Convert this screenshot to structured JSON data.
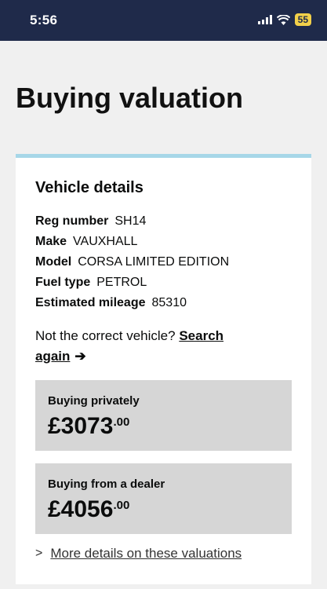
{
  "status": {
    "time": "5:56",
    "battery": "55"
  },
  "page": {
    "title": "Buying valuation"
  },
  "vehicle": {
    "heading": "Vehicle details",
    "reg_label": "Reg number",
    "reg_value": "SH14",
    "make_label": "Make",
    "make_value": "VAUXHALL",
    "model_label": "Model",
    "model_value": "CORSA LIMITED EDITION",
    "fuel_label": "Fuel type",
    "fuel_value": "PETROL",
    "mileage_label": "Estimated mileage",
    "mileage_value": "85310"
  },
  "search": {
    "prompt": "Not the correct vehicle?",
    "link": "Search again",
    "arrow_icon": "arrow-right"
  },
  "valuations": {
    "private_label": "Buying privately",
    "private_amount": "£3073",
    "private_pence": ".00",
    "dealer_label": "Buying from a dealer",
    "dealer_amount": "£4056",
    "dealer_pence": ".00"
  },
  "more": {
    "link": "More details on these valuations",
    "chevron_icon": "chevron-right"
  },
  "colors": {
    "status_bar": "#1f2a4a",
    "card_border": "#a7d7e8",
    "value_box": "#d6d6d6",
    "battery": "#f2d04a"
  }
}
